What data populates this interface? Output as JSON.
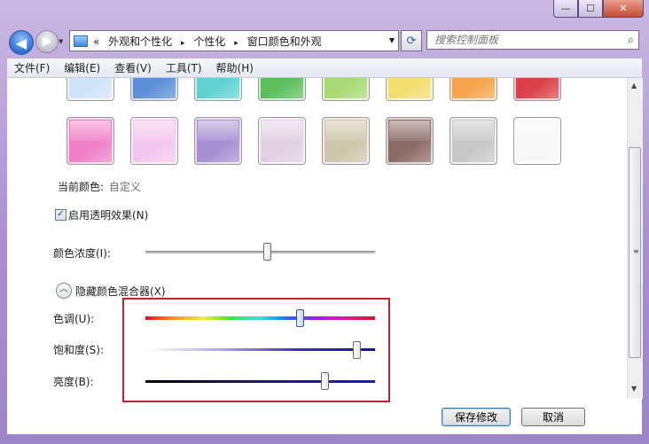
{
  "window": {
    "minimize_glyph": "—",
    "maximize_glyph": "☐",
    "close_glyph": "✕"
  },
  "nav": {
    "back_glyph": "◀",
    "forward_glyph": "▶",
    "breadcrumb": {
      "prefix": "«",
      "items": [
        "外观和个性化",
        "个性化",
        "窗口颜色和外观"
      ],
      "separator": "▸"
    },
    "search_placeholder": "搜索控制面板"
  },
  "menubar": {
    "items": [
      "文件(F)",
      "编辑(E)",
      "查看(V)",
      "工具(T)",
      "帮助(H)"
    ]
  },
  "swatches": {
    "row1_colors": [
      "#cfe3f8",
      "#5c8fd6",
      "#5fd1d3",
      "#5cbf5e",
      "#a8da74",
      "#f3dd6c",
      "#f5a44c",
      "#d94048"
    ],
    "row2_colors": [
      "#f07fc7",
      "#f4c6ef",
      "#a88fd1",
      "#e2cfe4",
      "#cfc5ab",
      "#8c6c66",
      "#c7c7c9",
      "#f7f7f9"
    ]
  },
  "current_color": {
    "label": "当前颜色:",
    "value": "自定义"
  },
  "transparency": {
    "label": "启用透明效果(N)",
    "checked": true
  },
  "intensity": {
    "label": "颜色浓度(I):",
    "level": 0.53
  },
  "mixer": {
    "toggle_label": "隐藏颜色混合器(X)",
    "hue": {
      "label": "色调(U):",
      "level": 0.67
    },
    "saturation": {
      "label": "饱和度(S):",
      "level": 0.92
    },
    "brightness": {
      "label": "亮度(B):",
      "level": 0.78
    }
  },
  "buttons": {
    "save": "保存修改",
    "cancel": "取消"
  },
  "colors": {
    "highlight_box": "#c4232b"
  }
}
